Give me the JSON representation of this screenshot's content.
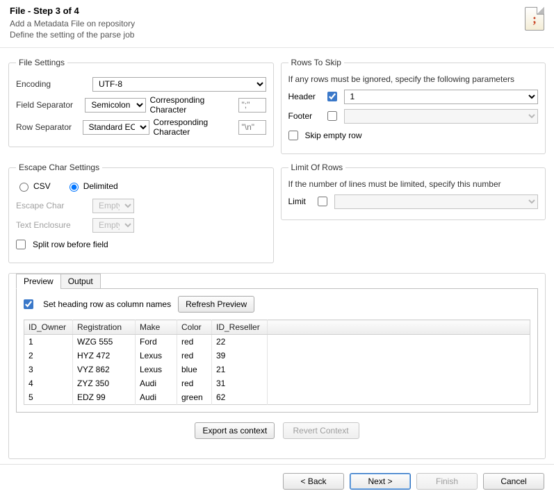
{
  "header": {
    "title": "File - Step 3 of 4",
    "subtitle1": "Add a Metadata File on repository",
    "subtitle2": "Define the setting of the parse job",
    "icon_glyph": ";"
  },
  "fileSettings": {
    "legend": "File Settings",
    "encoding_label": "Encoding",
    "encoding_value": "UTF-8",
    "fieldsep_label": "Field Separator",
    "fieldsep_value": "Semicolon",
    "rowsep_label": "Row Separator",
    "rowsep_value": "Standard EOL",
    "corresp_label": "Corresponding Character",
    "fieldsep_char": "\";\"",
    "rowsep_char": "\"\\n\""
  },
  "rowsToSkip": {
    "legend": "Rows To Skip",
    "note": "If any rows must be ignored, specify the following parameters",
    "header_label": "Header",
    "header_checked": true,
    "header_value": "1",
    "footer_label": "Footer",
    "footer_checked": false,
    "footer_value": "",
    "skip_empty_label": "Skip empty row",
    "skip_empty_checked": false
  },
  "escape": {
    "legend": "Escape Char Settings",
    "csv_label": "CSV",
    "delimited_label": "Delimited",
    "mode": "delimited",
    "escape_char_label": "Escape Char",
    "escape_char_value": "Empty",
    "text_enclosure_label": "Text Enclosure",
    "text_enclosure_value": "Empty",
    "split_label": "Split row before field",
    "split_checked": false
  },
  "limit": {
    "legend": "Limit Of Rows",
    "note": "If the number of lines must be limited, specify this number",
    "limit_label": "Limit",
    "limit_checked": false,
    "limit_value": ""
  },
  "preview": {
    "tab_preview": "Preview",
    "tab_output": "Output",
    "heading_checkbox_label": "Set heading row as column names",
    "heading_checked": true,
    "refresh_label": "Refresh Preview",
    "columns": [
      "ID_Owner",
      "Registration",
      "Make",
      "Color",
      "ID_Reseller"
    ],
    "rows": [
      [
        "1",
        "WZG 555",
        "Ford",
        "red",
        "22"
      ],
      [
        "2",
        "HYZ 472",
        "Lexus",
        "red",
        "39"
      ],
      [
        "3",
        "VYZ 862",
        "Lexus",
        "blue",
        "21"
      ],
      [
        "4",
        "ZYZ 350",
        "Audi",
        "red",
        "31"
      ],
      [
        "5",
        "EDZ 99",
        "Audi",
        "green",
        "62"
      ]
    ],
    "export_label": "Export as context",
    "revert_label": "Revert Context"
  },
  "footer": {
    "back": "< Back",
    "next": "Next >",
    "finish": "Finish",
    "cancel": "Cancel"
  }
}
